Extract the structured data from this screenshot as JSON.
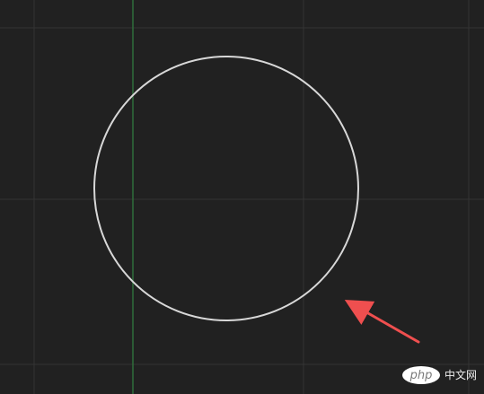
{
  "canvas": {
    "background": "#212121",
    "grid_color": "#343434",
    "axis_color": "#2f6d3b"
  },
  "drawing": {
    "object": "circle",
    "stroke": "#d8d8d8",
    "annotation_color": "#ef4f4f",
    "annotation_icon": "red-arrow-icon"
  },
  "watermark": {
    "logo_text": "php",
    "site_text": "中文网"
  }
}
